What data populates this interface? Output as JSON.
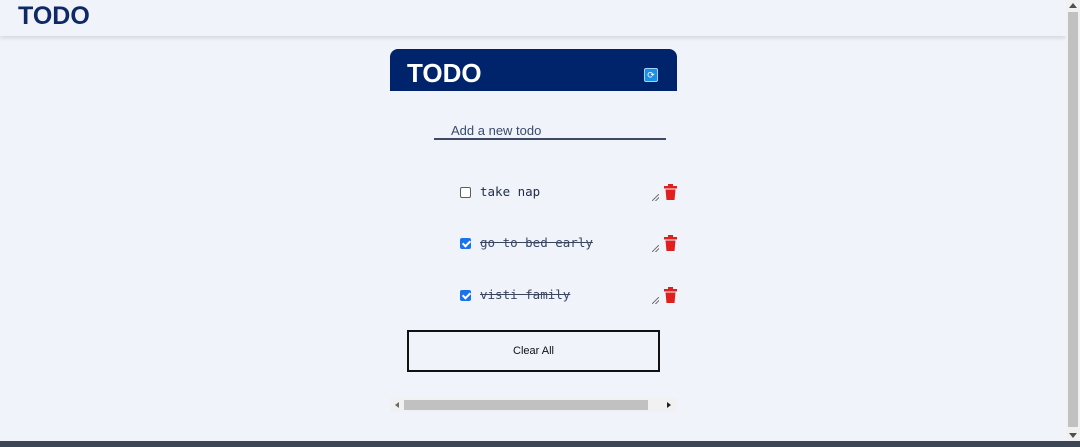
{
  "header": {
    "title": "TODO"
  },
  "card": {
    "title": "TODO",
    "refresh_icon": "refresh-icon"
  },
  "new_todo": {
    "placeholder": "Add a new todo",
    "value": ""
  },
  "todos": [
    {
      "text": "take nap",
      "done": false
    },
    {
      "text": "go to bed early",
      "done": true
    },
    {
      "text": "visti family",
      "done": true
    }
  ],
  "clear_button": {
    "label": "Clear All"
  },
  "colors": {
    "background": "#f0f3fa",
    "header_bg": "#00246b",
    "title_text": "#0e2a66",
    "delete_icon": "#e01f1f",
    "checkbox_checked": "#1a73e8"
  }
}
